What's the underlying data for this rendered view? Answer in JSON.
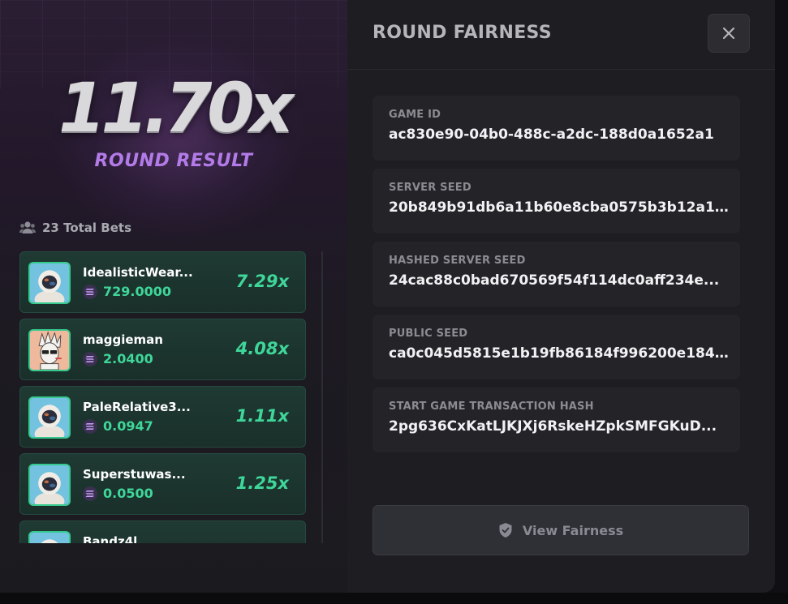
{
  "round": {
    "multiplier": "11.70x",
    "result_label": "ROUND RESULT"
  },
  "bets": {
    "header": "23 Total Bets",
    "header_icon": "users-icon",
    "items": [
      {
        "name": "IdealisticWear...",
        "amount": "729.0000",
        "multiplier": "7.29x",
        "avatar": "astronaut"
      },
      {
        "name": "maggieman",
        "amount": "2.0400",
        "multiplier": "4.08x",
        "avatar": "punk"
      },
      {
        "name": "PaleRelative3...",
        "amount": "0.0947",
        "multiplier": "1.11x",
        "avatar": "astronaut"
      },
      {
        "name": "Superstuwas...",
        "amount": "0.0500",
        "multiplier": "1.25x",
        "avatar": "astronaut"
      },
      {
        "name": "Bandz4l",
        "amount": "",
        "multiplier": "",
        "avatar": "astronaut"
      }
    ]
  },
  "fairness": {
    "title": "ROUND FAIRNESS",
    "close_icon": "close-icon",
    "fields": [
      {
        "label": "GAME ID",
        "value": "ac830e90-04b0-488c-a2dc-188d0a1652a1"
      },
      {
        "label": "SERVER SEED",
        "value": "20b849b91db6a11b60e8cba0575b3b12a11..."
      },
      {
        "label": "HASHED SERVER SEED",
        "value": "24cac88c0bad670569f54f114dc0aff234e..."
      },
      {
        "label": "PUBLIC SEED",
        "value": "ca0c045d5815e1b19fb86184f996200e184..."
      },
      {
        "label": "START GAME TRANSACTION HASH",
        "value": "2pg636CxKatLJKJXj6RskeHZpkSMFGKuD..."
      }
    ],
    "button_label": "View Fairness",
    "button_icon": "shield-check-icon"
  },
  "colors": {
    "accent_green": "#3fd69a",
    "accent_purple": "#b27be8",
    "panel_bg": "#1e1e22"
  }
}
